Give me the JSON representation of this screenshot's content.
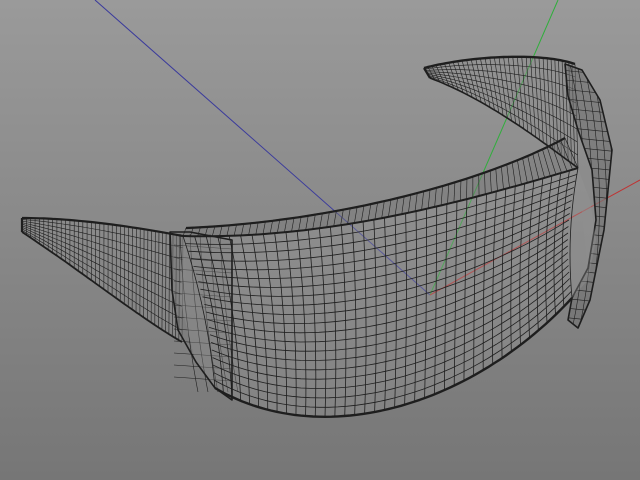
{
  "viewport": {
    "view": "3d-perspective",
    "display_mode": "wireframe",
    "model": "wraparound-sunglasses-mesh",
    "colors": {
      "background_top": "#9a9a9a",
      "background_bottom": "#767676",
      "wire": "#1e1e1e",
      "axis_x": "#c03232",
      "axis_y": "#2fae3b",
      "axis_z": "#3a3a9c"
    }
  }
}
